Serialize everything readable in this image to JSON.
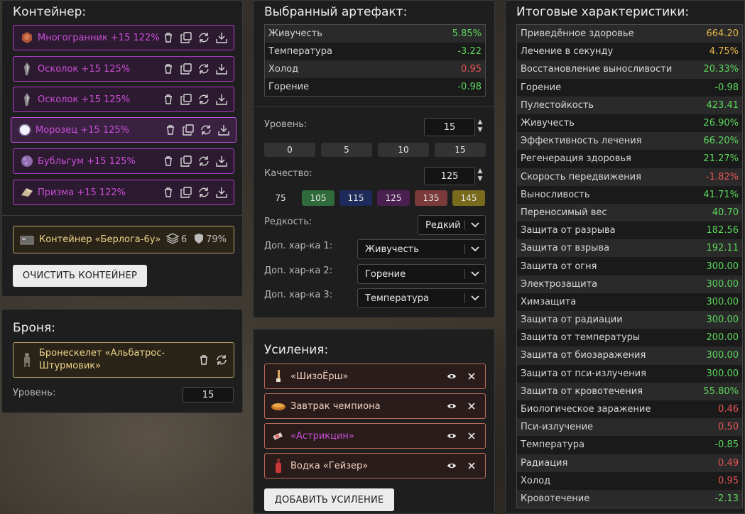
{
  "container": {
    "title": "Контейнер:",
    "artifacts": [
      {
        "name": "Многогранник +15 122%",
        "icon": "polyhedron-icon"
      },
      {
        "name": "Осколок +15 125%",
        "icon": "shard-icon"
      },
      {
        "name": "Осколок +15 125%",
        "icon": "shard-icon"
      },
      {
        "name": "Морозец +15 125%",
        "icon": "frost-icon"
      },
      {
        "name": "Бубльгум +15 125%",
        "icon": "bubblegum-icon"
      },
      {
        "name": "Призма +15 122%",
        "icon": "prism-icon"
      }
    ],
    "container_name": "Контейнер «Берлога-6у»",
    "slots": "6",
    "protection": "79%",
    "clear_button": "ОЧИСТИТЬ КОНТЕЙНЕР"
  },
  "armor": {
    "title": "Броня:",
    "name": "Бронескелет «Альбатрос-Штурмовик»",
    "level_label": "Уровень:",
    "level_value": "15"
  },
  "artifact": {
    "title": "Выбранный артефакт:",
    "stats": [
      {
        "name": "Живучесть",
        "value": "5.85%",
        "tone": "pos"
      },
      {
        "name": "Температура",
        "value": "-3.22",
        "tone": "pos"
      },
      {
        "name": "Холод",
        "value": "0.95",
        "tone": "neg"
      },
      {
        "name": "Горение",
        "value": "-0.98",
        "tone": "pos"
      }
    ],
    "level_label": "Уровень:",
    "level_value": "15",
    "level_presets": [
      "0",
      "5",
      "10",
      "15"
    ],
    "quality_label": "Качество:",
    "quality_value": "125",
    "quality_presets": [
      {
        "label": "75",
        "color": "#1e1e1e"
      },
      {
        "label": "105",
        "color": "#2e6a3a"
      },
      {
        "label": "115",
        "color": "#1e2a5a"
      },
      {
        "label": "125",
        "color": "#4a2050"
      },
      {
        "label": "135",
        "color": "#7a3a3a"
      },
      {
        "label": "145",
        "color": "#7a6a1e"
      }
    ],
    "rarity_label": "Редкость:",
    "rarity_value": "Редкий",
    "extra1_label": "Доп. хар-ка 1:",
    "extra1_value": "Живучесть",
    "extra2_label": "Доп. хар-ка 2:",
    "extra2_value": "Горение",
    "extra3_label": "Доп. хар-ка 3:",
    "extra3_value": "Температура"
  },
  "boosts": {
    "title": "Усиления:",
    "items": [
      {
        "name": "«ШизоЁрш»",
        "icon": "brush-icon",
        "tone": "normal"
      },
      {
        "name": "Завтрак чемпиона",
        "icon": "bowl-icon",
        "tone": "normal"
      },
      {
        "name": "«Астрикцин»",
        "icon": "syringe-icon",
        "tone": "purple"
      },
      {
        "name": "Водка «Гейзер»",
        "icon": "bottle-icon",
        "tone": "normal"
      }
    ],
    "add_button": "ДОБАВИТЬ УСИЛЕНИЕ"
  },
  "totals": {
    "title": "Итоговые характеристики:",
    "rows": [
      {
        "name": "Приведённое здоровье",
        "value": "664.20",
        "tone": "neu"
      },
      {
        "name": "Лечение в секунду",
        "value": "4.75%",
        "tone": "neu"
      },
      {
        "name": "Восстановление выносливости",
        "value": "20.33%",
        "tone": "pos"
      },
      {
        "name": "Горение",
        "value": "-0.98",
        "tone": "pos"
      },
      {
        "name": "Пулестойкость",
        "value": "423.41",
        "tone": "pos"
      },
      {
        "name": "Живучесть",
        "value": "26.90%",
        "tone": "pos"
      },
      {
        "name": "Эффективность лечения",
        "value": "66.20%",
        "tone": "pos"
      },
      {
        "name": "Регенерация здоровья",
        "value": "21.27%",
        "tone": "pos"
      },
      {
        "name": "Скорость передвижения",
        "value": "-1.82%",
        "tone": "neg"
      },
      {
        "name": "Выносливость",
        "value": "41.71%",
        "tone": "pos"
      },
      {
        "name": "Переносимый вес",
        "value": "40.70",
        "tone": "pos"
      },
      {
        "name": "Защита от разрыва",
        "value": "182.56",
        "tone": "pos"
      },
      {
        "name": "Защита от взрыва",
        "value": "192.11",
        "tone": "pos"
      },
      {
        "name": "Защита от огня",
        "value": "300.00",
        "tone": "pos"
      },
      {
        "name": "Электрозащита",
        "value": "300.00",
        "tone": "pos"
      },
      {
        "name": "Химзащита",
        "value": "300.00",
        "tone": "pos"
      },
      {
        "name": "Защита от радиации",
        "value": "300.00",
        "tone": "pos"
      },
      {
        "name": "Защита от температуры",
        "value": "200.00",
        "tone": "pos"
      },
      {
        "name": "Защита от биозаражения",
        "value": "300.00",
        "tone": "pos"
      },
      {
        "name": "Защита от пси-излучения",
        "value": "300.00",
        "tone": "pos"
      },
      {
        "name": "Защита от кровотечения",
        "value": "55.80%",
        "tone": "pos"
      },
      {
        "name": "Биологическое заражение",
        "value": "0.46",
        "tone": "neg"
      },
      {
        "name": "Пси-излучение",
        "value": "0.50",
        "tone": "neg"
      },
      {
        "name": "Температура",
        "value": "-0.85",
        "tone": "pos"
      },
      {
        "name": "Радиация",
        "value": "0.49",
        "tone": "neg"
      },
      {
        "name": "Холод",
        "value": "0.95",
        "tone": "neg"
      },
      {
        "name": "Кровотечение",
        "value": "-2.13",
        "tone": "pos"
      }
    ]
  }
}
